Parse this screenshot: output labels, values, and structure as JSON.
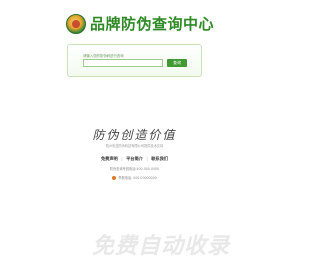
{
  "header": {
    "logo_icon": "brand-seal-icon",
    "title": "品牌防伪查询中心"
  },
  "search": {
    "hint": "请输入您的防伪码进行查询",
    "value": "",
    "placeholder": "",
    "button_label": "查询"
  },
  "slogan": {
    "title": "防伪创造价值",
    "subtitle": "杭州彩盒防伪科技有限公司提供技术支持"
  },
  "links": [
    {
      "label": "免费声明"
    },
    {
      "label": "平台简介"
    },
    {
      "label": "联系我们"
    }
  ],
  "footer": {
    "hotline": "防伪查询专线电话:400-000-0000",
    "report": "举报电话: 000-00000000"
  },
  "watermark": "免费自动收录",
  "colors": {
    "brand_green": "#2f8a26",
    "button_green": "#3f9a33",
    "panel_border": "#c9e3bf"
  }
}
